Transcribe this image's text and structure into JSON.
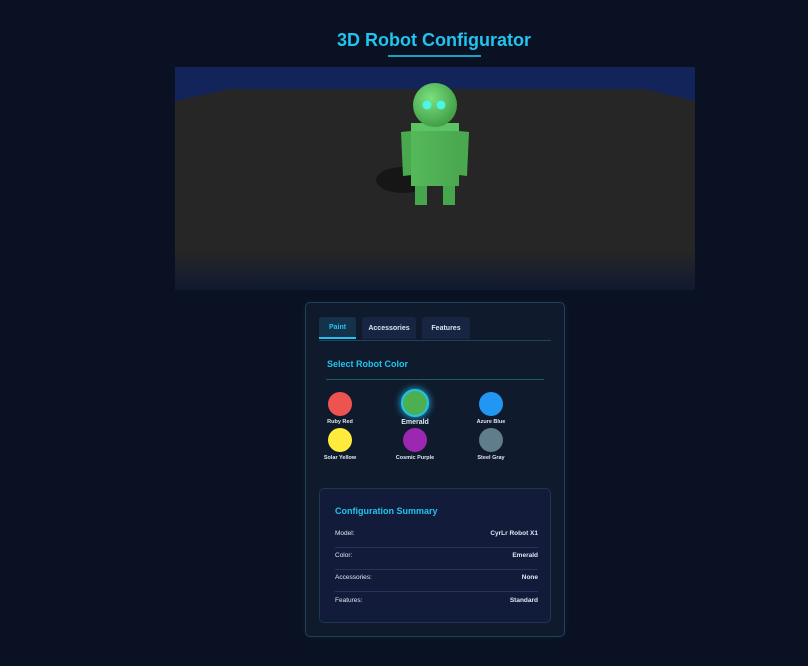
{
  "app": {
    "title": "3D Robot Configurator"
  },
  "tabs": [
    {
      "label": "Paint",
      "active": true
    },
    {
      "label": "Accessories",
      "active": false
    },
    {
      "label": "Features",
      "active": false
    }
  ],
  "paint": {
    "heading": "Select Robot Color",
    "colors": [
      {
        "name": "Ruby Red",
        "hex": "#ef5350",
        "selected": false
      },
      {
        "name": "Emerald",
        "hex": "#4caf50",
        "selected": true
      },
      {
        "name": "Azure Blue",
        "hex": "#2196f3",
        "selected": false
      },
      {
        "name": "Solar Yellow",
        "hex": "#ffeb3b",
        "selected": false
      },
      {
        "name": "Cosmic Purple",
        "hex": "#9c27b0",
        "selected": false
      },
      {
        "name": "Steel Gray",
        "hex": "#607d8b",
        "selected": false
      }
    ]
  },
  "summary": {
    "title": "Configuration Summary",
    "rows": [
      {
        "key": "Model:",
        "value": "CyrLr Robot X1"
      },
      {
        "key": "Color:",
        "value": "Emerald"
      },
      {
        "key": "Accessories:",
        "value": "None"
      },
      {
        "key": "Features:",
        "value": "Standard"
      }
    ]
  },
  "theme": {
    "accent": "#22c3ee",
    "background": "#0a1122",
    "robot_color": "#4caf50",
    "eye_color": "#4df5e4"
  }
}
